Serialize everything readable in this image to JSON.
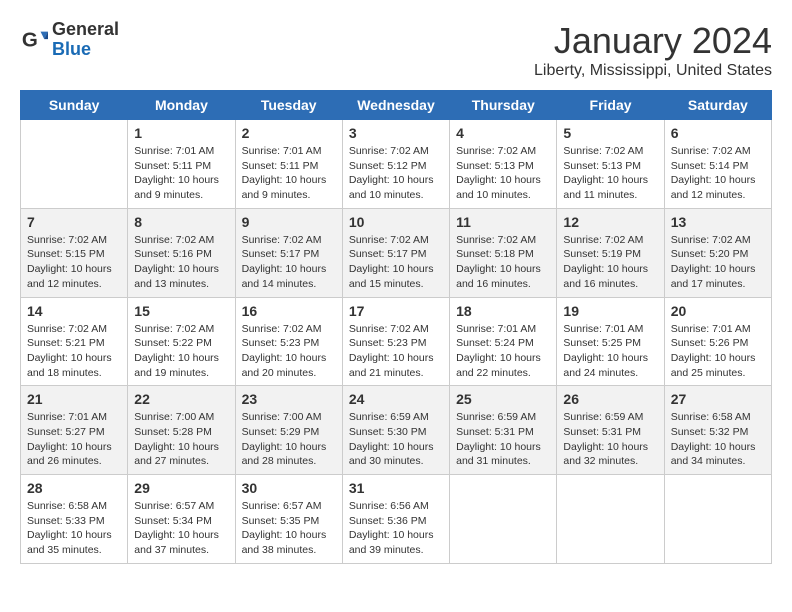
{
  "header": {
    "logo_general": "General",
    "logo_blue": "Blue",
    "title": "January 2024",
    "location": "Liberty, Mississippi, United States"
  },
  "days_of_week": [
    "Sunday",
    "Monday",
    "Tuesday",
    "Wednesday",
    "Thursday",
    "Friday",
    "Saturday"
  ],
  "weeks": [
    [
      {
        "day": "",
        "info": ""
      },
      {
        "day": "1",
        "info": "Sunrise: 7:01 AM\nSunset: 5:11 PM\nDaylight: 10 hours\nand 9 minutes."
      },
      {
        "day": "2",
        "info": "Sunrise: 7:01 AM\nSunset: 5:11 PM\nDaylight: 10 hours\nand 9 minutes."
      },
      {
        "day": "3",
        "info": "Sunrise: 7:02 AM\nSunset: 5:12 PM\nDaylight: 10 hours\nand 10 minutes."
      },
      {
        "day": "4",
        "info": "Sunrise: 7:02 AM\nSunset: 5:13 PM\nDaylight: 10 hours\nand 10 minutes."
      },
      {
        "day": "5",
        "info": "Sunrise: 7:02 AM\nSunset: 5:13 PM\nDaylight: 10 hours\nand 11 minutes."
      },
      {
        "day": "6",
        "info": "Sunrise: 7:02 AM\nSunset: 5:14 PM\nDaylight: 10 hours\nand 12 minutes."
      }
    ],
    [
      {
        "day": "7",
        "info": "Sunrise: 7:02 AM\nSunset: 5:15 PM\nDaylight: 10 hours\nand 12 minutes."
      },
      {
        "day": "8",
        "info": "Sunrise: 7:02 AM\nSunset: 5:16 PM\nDaylight: 10 hours\nand 13 minutes."
      },
      {
        "day": "9",
        "info": "Sunrise: 7:02 AM\nSunset: 5:17 PM\nDaylight: 10 hours\nand 14 minutes."
      },
      {
        "day": "10",
        "info": "Sunrise: 7:02 AM\nSunset: 5:17 PM\nDaylight: 10 hours\nand 15 minutes."
      },
      {
        "day": "11",
        "info": "Sunrise: 7:02 AM\nSunset: 5:18 PM\nDaylight: 10 hours\nand 16 minutes."
      },
      {
        "day": "12",
        "info": "Sunrise: 7:02 AM\nSunset: 5:19 PM\nDaylight: 10 hours\nand 16 minutes."
      },
      {
        "day": "13",
        "info": "Sunrise: 7:02 AM\nSunset: 5:20 PM\nDaylight: 10 hours\nand 17 minutes."
      }
    ],
    [
      {
        "day": "14",
        "info": "Sunrise: 7:02 AM\nSunset: 5:21 PM\nDaylight: 10 hours\nand 18 minutes."
      },
      {
        "day": "15",
        "info": "Sunrise: 7:02 AM\nSunset: 5:22 PM\nDaylight: 10 hours\nand 19 minutes."
      },
      {
        "day": "16",
        "info": "Sunrise: 7:02 AM\nSunset: 5:23 PM\nDaylight: 10 hours\nand 20 minutes."
      },
      {
        "day": "17",
        "info": "Sunrise: 7:02 AM\nSunset: 5:23 PM\nDaylight: 10 hours\nand 21 minutes."
      },
      {
        "day": "18",
        "info": "Sunrise: 7:01 AM\nSunset: 5:24 PM\nDaylight: 10 hours\nand 22 minutes."
      },
      {
        "day": "19",
        "info": "Sunrise: 7:01 AM\nSunset: 5:25 PM\nDaylight: 10 hours\nand 24 minutes."
      },
      {
        "day": "20",
        "info": "Sunrise: 7:01 AM\nSunset: 5:26 PM\nDaylight: 10 hours\nand 25 minutes."
      }
    ],
    [
      {
        "day": "21",
        "info": "Sunrise: 7:01 AM\nSunset: 5:27 PM\nDaylight: 10 hours\nand 26 minutes."
      },
      {
        "day": "22",
        "info": "Sunrise: 7:00 AM\nSunset: 5:28 PM\nDaylight: 10 hours\nand 27 minutes."
      },
      {
        "day": "23",
        "info": "Sunrise: 7:00 AM\nSunset: 5:29 PM\nDaylight: 10 hours\nand 28 minutes."
      },
      {
        "day": "24",
        "info": "Sunrise: 6:59 AM\nSunset: 5:30 PM\nDaylight: 10 hours\nand 30 minutes."
      },
      {
        "day": "25",
        "info": "Sunrise: 6:59 AM\nSunset: 5:31 PM\nDaylight: 10 hours\nand 31 minutes."
      },
      {
        "day": "26",
        "info": "Sunrise: 6:59 AM\nSunset: 5:31 PM\nDaylight: 10 hours\nand 32 minutes."
      },
      {
        "day": "27",
        "info": "Sunrise: 6:58 AM\nSunset: 5:32 PM\nDaylight: 10 hours\nand 34 minutes."
      }
    ],
    [
      {
        "day": "28",
        "info": "Sunrise: 6:58 AM\nSunset: 5:33 PM\nDaylight: 10 hours\nand 35 minutes."
      },
      {
        "day": "29",
        "info": "Sunrise: 6:57 AM\nSunset: 5:34 PM\nDaylight: 10 hours\nand 37 minutes."
      },
      {
        "day": "30",
        "info": "Sunrise: 6:57 AM\nSunset: 5:35 PM\nDaylight: 10 hours\nand 38 minutes."
      },
      {
        "day": "31",
        "info": "Sunrise: 6:56 AM\nSunset: 5:36 PM\nDaylight: 10 hours\nand 39 minutes."
      },
      {
        "day": "",
        "info": ""
      },
      {
        "day": "",
        "info": ""
      },
      {
        "day": "",
        "info": ""
      }
    ]
  ]
}
